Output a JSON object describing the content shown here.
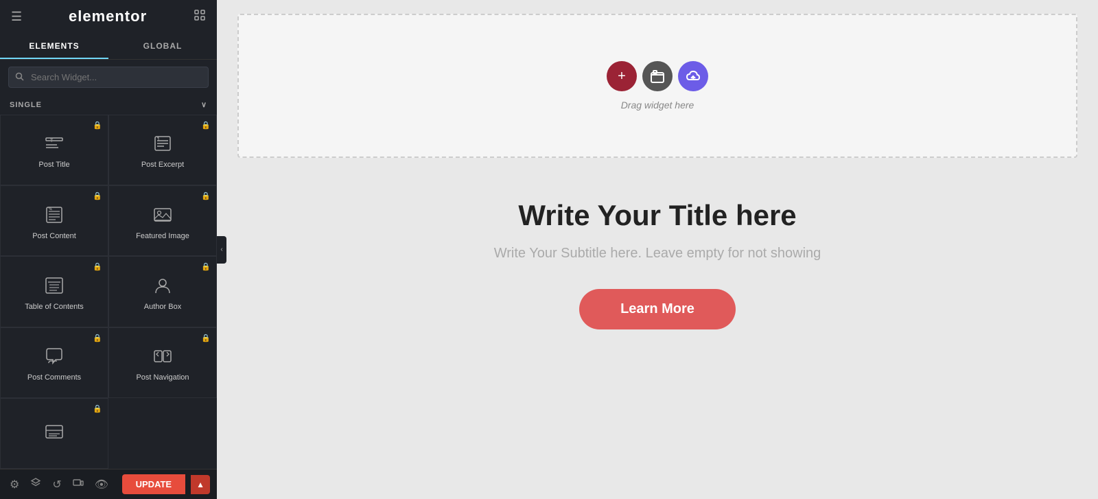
{
  "header": {
    "logo": "elementor",
    "hamburger_icon": "☰",
    "grid_icon": "⊞"
  },
  "tabs": [
    {
      "label": "ELEMENTS",
      "active": true
    },
    {
      "label": "GLOBAL",
      "active": false
    }
  ],
  "search": {
    "placeholder": "Search Widget..."
  },
  "section": {
    "label": "SINGLE",
    "chevron": "∨"
  },
  "widgets": [
    {
      "id": "post-title",
      "label": "Post Title",
      "locked": true,
      "icon": "post-title"
    },
    {
      "id": "post-excerpt",
      "label": "Post Excerpt",
      "locked": true,
      "icon": "post-excerpt"
    },
    {
      "id": "post-content",
      "label": "Post Content",
      "locked": true,
      "icon": "post-content"
    },
    {
      "id": "featured-image",
      "label": "Featured Image",
      "locked": true,
      "icon": "featured-image"
    },
    {
      "id": "table-of-contents",
      "label": "Table of Contents",
      "locked": true,
      "icon": "table-of-contents"
    },
    {
      "id": "author-box",
      "label": "Author Box",
      "locked": true,
      "icon": "author-box"
    },
    {
      "id": "post-comments",
      "label": "Post Comments",
      "locked": true,
      "icon": "post-comments"
    },
    {
      "id": "post-navigation",
      "label": "Post Navigation",
      "locked": true,
      "icon": "post-navigation"
    },
    {
      "id": "more-widget",
      "label": "",
      "locked": true,
      "icon": "more"
    }
  ],
  "canvas": {
    "drag_hint": "Drag widget here",
    "action_buttons": [
      {
        "id": "add-btn",
        "icon": "+",
        "label": "Add",
        "color": "#9b2335"
      },
      {
        "id": "folder-btn",
        "icon": "▣",
        "label": "Folder",
        "color": "#555"
      },
      {
        "id": "cloud-btn",
        "icon": "☁",
        "label": "Cloud",
        "color": "#6c5ce7"
      }
    ]
  },
  "content": {
    "title": "Write Your Title here",
    "subtitle": "Write Your Subtitle here. Leave empty for not showing",
    "cta_label": "Learn More"
  },
  "bottom_bar": {
    "update_label": "UPDATE",
    "icons": [
      "settings",
      "layers",
      "history",
      "responsive",
      "eye"
    ]
  }
}
